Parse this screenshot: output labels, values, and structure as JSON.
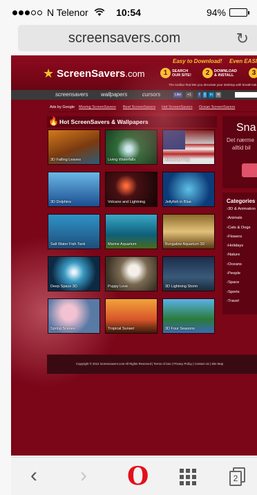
{
  "status_bar": {
    "carrier": "N Telenor",
    "time": "10:54",
    "battery": "94%",
    "battery_level": 0.94
  },
  "address_bar": {
    "url": "screensavers.com",
    "reload_icon": "reload-icon"
  },
  "site": {
    "logo": {
      "name": "ScreenSavers",
      "suffix": ".com"
    },
    "tagline_easy": "Easy to Download!",
    "tagline_easier": "Even EASIER",
    "steps": [
      {
        "num": "1",
        "label": "SEARCH OUR SITE!"
      },
      {
        "num": "2",
        "label": "DOWNLOAD & INSTALL"
      },
      {
        "num": "3",
        "label": ""
      }
    ],
    "toolbar_note": "The toolbar that lets you decorate your desktop with breath-tak",
    "nav": [
      "screensavers",
      "wallpapers",
      "cursors"
    ],
    "share": [
      "Like",
      "+1",
      "f",
      "t",
      "in",
      "✉"
    ],
    "ads_label": "Ads by Google",
    "ads": [
      "Moving ScreenSavers",
      "Best ScreenSavers",
      "Hot ScreenSavers",
      "Ocean ScreenSavers"
    ],
    "section_title": "Hot ScreenSavers & Wallpapers",
    "thumbnails": [
      "3D Falling Leaves",
      "Living Waterfalls",
      "American Flag",
      "3D Dolphins",
      "Volcano and Lightning",
      "Jellyfish in Blue",
      "Salt Water Fish Tank",
      "Marine Aquarium",
      "Bungalow Aquarium 3D",
      "Deep Space 3D",
      "Puppy Love",
      "3D Lightning Storm",
      "Spring Scenes",
      "Tropical Sunset",
      "3D Four Seasons"
    ],
    "side_panel": {
      "title": "Sna",
      "line1": "Det nærme",
      "line2": "alltid bil"
    },
    "categories_title": "Categories",
    "categories": [
      "3D & Animation",
      "Animals",
      "Cats & Dogs",
      "Flowers",
      "Holidays",
      "Nature",
      "Oceans",
      "People",
      "Space",
      "Sports",
      "Travel"
    ],
    "footer": "Copyright © 2014 Screensavers.com All Rights Reserved | Terms of Use | Privacy Policy | Contact Us | Site Map"
  },
  "bottom_bar": {
    "back": "‹",
    "forward": "›",
    "opera": "O",
    "tab_count": "2"
  }
}
